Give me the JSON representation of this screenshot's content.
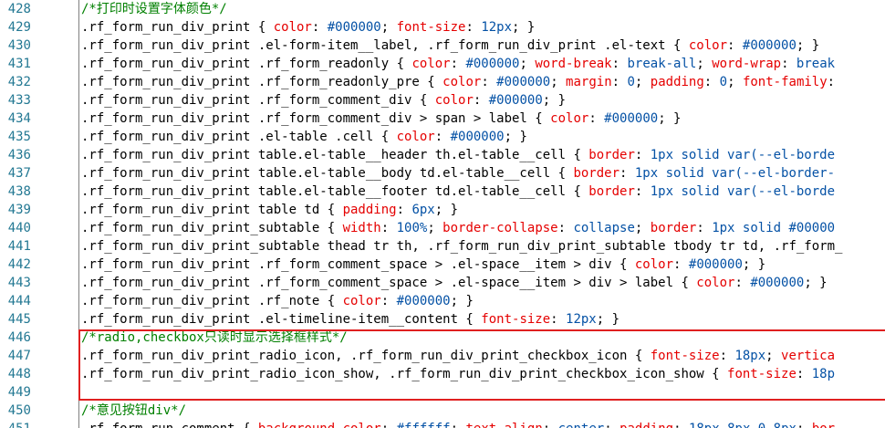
{
  "colors": {
    "line_number": "#237893",
    "selector": "#000000",
    "property": "#e50000",
    "value": "#0451a5",
    "comment": "#008000",
    "highlight_border": "#e02020"
  },
  "lines": [
    {
      "no": "428",
      "tokens": [
        [
          "comment",
          "/*打印时设置字体颜色*/"
        ]
      ]
    },
    {
      "no": "429",
      "tokens": [
        [
          "sel",
          ".rf_form_run_div_print { "
        ],
        [
          "prop",
          "color"
        ],
        [
          "txt",
          ": "
        ],
        [
          "val",
          "#000000"
        ],
        [
          "txt",
          "; "
        ],
        [
          "prop",
          "font-size"
        ],
        [
          "txt",
          ": "
        ],
        [
          "val",
          "12px"
        ],
        [
          "txt",
          "; }"
        ]
      ]
    },
    {
      "no": "430",
      "tokens": [
        [
          "sel",
          ".rf_form_run_div_print .el-form-item__label, .rf_form_run_div_print .el-text { "
        ],
        [
          "prop",
          "color"
        ],
        [
          "txt",
          ": "
        ],
        [
          "val",
          "#000000"
        ],
        [
          "txt",
          "; }"
        ]
      ]
    },
    {
      "no": "431",
      "tokens": [
        [
          "sel",
          ".rf_form_run_div_print .rf_form_readonly { "
        ],
        [
          "prop",
          "color"
        ],
        [
          "txt",
          ": "
        ],
        [
          "val",
          "#000000"
        ],
        [
          "txt",
          "; "
        ],
        [
          "prop",
          "word-break"
        ],
        [
          "txt",
          ": "
        ],
        [
          "val",
          "break-all"
        ],
        [
          "txt",
          "; "
        ],
        [
          "prop",
          "word-wrap"
        ],
        [
          "txt",
          ": "
        ],
        [
          "val",
          "break"
        ]
      ]
    },
    {
      "no": "432",
      "tokens": [
        [
          "sel",
          ".rf_form_run_div_print .rf_form_readonly_pre { "
        ],
        [
          "prop",
          "color"
        ],
        [
          "txt",
          ": "
        ],
        [
          "val",
          "#000000"
        ],
        [
          "txt",
          "; "
        ],
        [
          "prop",
          "margin"
        ],
        [
          "txt",
          ": "
        ],
        [
          "val",
          "0"
        ],
        [
          "txt",
          "; "
        ],
        [
          "prop",
          "padding"
        ],
        [
          "txt",
          ": "
        ],
        [
          "val",
          "0"
        ],
        [
          "txt",
          "; "
        ],
        [
          "prop",
          "font-family"
        ],
        [
          "txt",
          ":"
        ]
      ]
    },
    {
      "no": "433",
      "tokens": [
        [
          "sel",
          ".rf_form_run_div_print .rf_form_comment_div { "
        ],
        [
          "prop",
          "color"
        ],
        [
          "txt",
          ": "
        ],
        [
          "val",
          "#000000"
        ],
        [
          "txt",
          "; }"
        ]
      ]
    },
    {
      "no": "434",
      "tokens": [
        [
          "sel",
          ".rf_form_run_div_print .rf_form_comment_div > span > label { "
        ],
        [
          "prop",
          "color"
        ],
        [
          "txt",
          ": "
        ],
        [
          "val",
          "#000000"
        ],
        [
          "txt",
          "; }"
        ]
      ]
    },
    {
      "no": "435",
      "tokens": [
        [
          "sel",
          ".rf_form_run_div_print .el-table .cell { "
        ],
        [
          "prop",
          "color"
        ],
        [
          "txt",
          ": "
        ],
        [
          "val",
          "#000000"
        ],
        [
          "txt",
          "; }"
        ]
      ]
    },
    {
      "no": "436",
      "tokens": [
        [
          "sel",
          ".rf_form_run_div_print table.el-table__header th.el-table__cell { "
        ],
        [
          "prop",
          "border"
        ],
        [
          "txt",
          ": "
        ],
        [
          "val",
          "1px solid var(--el-borde"
        ]
      ]
    },
    {
      "no": "437",
      "tokens": [
        [
          "sel",
          ".rf_form_run_div_print table.el-table__body td.el-table__cell { "
        ],
        [
          "prop",
          "border"
        ],
        [
          "txt",
          ": "
        ],
        [
          "val",
          "1px solid var(--el-border-"
        ]
      ]
    },
    {
      "no": "438",
      "tokens": [
        [
          "sel",
          ".rf_form_run_div_print table.el-table__footer td.el-table__cell { "
        ],
        [
          "prop",
          "border"
        ],
        [
          "txt",
          ": "
        ],
        [
          "val",
          "1px solid var(--el-borde"
        ]
      ]
    },
    {
      "no": "439",
      "tokens": [
        [
          "sel",
          ".rf_form_run_div_print table td { "
        ],
        [
          "prop",
          "padding"
        ],
        [
          "txt",
          ": "
        ],
        [
          "val",
          "6px"
        ],
        [
          "txt",
          "; }"
        ]
      ]
    },
    {
      "no": "440",
      "tokens": [
        [
          "sel",
          ".rf_form_run_div_print_subtable { "
        ],
        [
          "prop",
          "width"
        ],
        [
          "txt",
          ": "
        ],
        [
          "val",
          "100%"
        ],
        [
          "txt",
          "; "
        ],
        [
          "prop",
          "border-collapse"
        ],
        [
          "txt",
          ": "
        ],
        [
          "val",
          "collapse"
        ],
        [
          "txt",
          "; "
        ],
        [
          "prop",
          "border"
        ],
        [
          "txt",
          ": "
        ],
        [
          "val",
          "1px solid #00000"
        ]
      ]
    },
    {
      "no": "441",
      "tokens": [
        [
          "sel",
          ".rf_form_run_div_print_subtable thead tr th, .rf_form_run_div_print_subtable tbody tr td, .rf_form_"
        ]
      ]
    },
    {
      "no": "442",
      "tokens": [
        [
          "sel",
          ".rf_form_run_div_print .rf_form_comment_space > .el-space__item > div { "
        ],
        [
          "prop",
          "color"
        ],
        [
          "txt",
          ": "
        ],
        [
          "val",
          "#000000"
        ],
        [
          "txt",
          "; }"
        ]
      ]
    },
    {
      "no": "443",
      "tokens": [
        [
          "sel",
          ".rf_form_run_div_print .rf_form_comment_space > .el-space__item > div > label { "
        ],
        [
          "prop",
          "color"
        ],
        [
          "txt",
          ": "
        ],
        [
          "val",
          "#000000"
        ],
        [
          "txt",
          "; }"
        ]
      ]
    },
    {
      "no": "444",
      "tokens": [
        [
          "sel",
          ".rf_form_run_div_print .rf_note { "
        ],
        [
          "prop",
          "color"
        ],
        [
          "txt",
          ": "
        ],
        [
          "val",
          "#000000"
        ],
        [
          "txt",
          "; }"
        ]
      ]
    },
    {
      "no": "445",
      "tokens": [
        [
          "sel",
          ".rf_form_run_div_print .el-timeline-item__content { "
        ],
        [
          "prop",
          "font-size"
        ],
        [
          "txt",
          ": "
        ],
        [
          "val",
          "12px"
        ],
        [
          "txt",
          "; }"
        ]
      ]
    },
    {
      "no": "446",
      "tokens": [
        [
          "comment",
          "/*radio,checkbox只读时显示选择框样式*/"
        ]
      ]
    },
    {
      "no": "447",
      "tokens": [
        [
          "sel",
          ".rf_form_run_div_print_radio_icon, .rf_form_run_div_print_checkbox_icon { "
        ],
        [
          "prop",
          "font-size"
        ],
        [
          "txt",
          ": "
        ],
        [
          "val",
          "18px"
        ],
        [
          "txt",
          "; "
        ],
        [
          "prop",
          "vertica"
        ]
      ]
    },
    {
      "no": "448",
      "tokens": [
        [
          "sel",
          ".rf_form_run_div_print_radio_icon_show, .rf_form_run_div_print_checkbox_icon_show { "
        ],
        [
          "prop",
          "font-size"
        ],
        [
          "txt",
          ": "
        ],
        [
          "val",
          "18p"
        ]
      ]
    },
    {
      "no": "449",
      "tokens": []
    },
    {
      "no": "450",
      "tokens": [
        [
          "comment",
          "/*意见按钮div*/"
        ]
      ]
    },
    {
      "no": "451",
      "tokens": [
        [
          "sel",
          ".rf_form_run_comment { "
        ],
        [
          "prop",
          "background-color"
        ],
        [
          "txt",
          ": "
        ],
        [
          "val",
          "#ffffff"
        ],
        [
          "txt",
          "; "
        ],
        [
          "prop",
          "text-align"
        ],
        [
          "txt",
          ": "
        ],
        [
          "val",
          "center"
        ],
        [
          "txt",
          "; "
        ],
        [
          "prop",
          "padding"
        ],
        [
          "txt",
          ": "
        ],
        [
          "val",
          "18px 8px 0 8px"
        ],
        [
          "txt",
          "; "
        ],
        [
          "prop",
          "bor"
        ]
      ]
    }
  ]
}
